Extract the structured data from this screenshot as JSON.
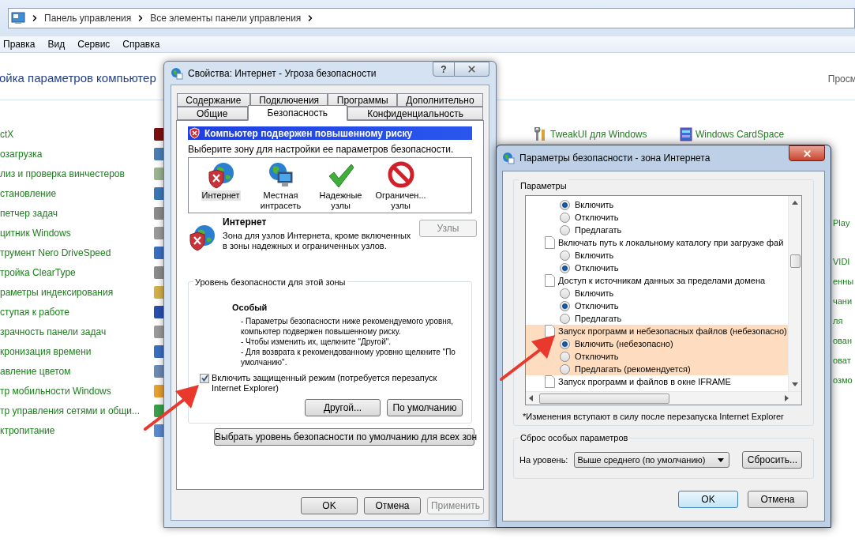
{
  "explorer": {
    "breadcrumb": [
      "Панель управления",
      "Все элементы панели управления"
    ],
    "menu": [
      "Правка",
      "Вид",
      "Сервис",
      "Справка"
    ],
    "heading": "ойка параметров компьютер",
    "view_link": "Просм",
    "items_left": [
      "ctX",
      "озагрузка",
      "лиз и проверка винчестеров",
      "становление",
      "петчер задач",
      "цитник Windows",
      "трумент Nero DriveSpeed",
      "тройка ClearType",
      "раметры индексирования",
      "ступая к работе",
      "зрачность панели задач",
      "кронизация времени",
      "авление цветом",
      "тр мобильности Windows",
      "тр управления сетями и общи...",
      "ктропитание"
    ],
    "items_right": [
      "TweakUI для Windows",
      "Windows CardSpace"
    ],
    "fragments_right": [
      "Play",
      "VIDI",
      "енны",
      "чани",
      "ля",
      "ован",
      "оват",
      "озмо"
    ]
  },
  "properties_dialog": {
    "title": "Свойства: Интернет - Угроза безопасности",
    "help": "?",
    "tab_rows": [
      [
        {
          "label": "Содержание",
          "selected": false
        },
        {
          "label": "Подключения",
          "selected": false
        },
        {
          "label": "Программы",
          "selected": false
        },
        {
          "label": "Дополнительно",
          "selected": false
        }
      ],
      [
        {
          "label": "Общие",
          "selected": false
        },
        {
          "label": "Безопасность",
          "selected": true
        },
        {
          "label": "Конфиденциальность",
          "selected": false
        }
      ]
    ],
    "warning": "Компьютер подвержен повышенному риску",
    "zone_prompt": "Выберите зону для настройки ее параметров безопасности.",
    "zones": [
      {
        "kind": "internet",
        "label": "Интернет",
        "selected": true
      },
      {
        "kind": "intranet",
        "label": "Местная\nинтрасеть",
        "selected": false
      },
      {
        "kind": "trusted",
        "label": "Надежные\nузлы",
        "selected": false
      },
      {
        "kind": "restricted",
        "label": "Ограничен...\nузлы",
        "selected": false
      }
    ],
    "zone_info": {
      "title": "Интернет",
      "description": "Зона для узлов Интернета, кроме включенных в зоны надежных и ограниченных узлов.",
      "sites_button": {
        "label": "Узлы",
        "disabled": true
      }
    },
    "level_group": {
      "legend": "Уровень безопасности для этой зоны",
      "level_name": "Особый",
      "lines": [
        "- Параметры безопасности ниже рекомендуемого уровня, компьютер подвержен повышенному риску.",
        "- Чтобы изменить их, щелкните \"Другой\".",
        "- Для возврата к рекомендованному уровню щелкните \"По умолчанию\"."
      ],
      "protected_mode": {
        "label": "Включить защищенный режим (потребуется перезапуск Internet Explorer)",
        "checked": true
      },
      "buttons": [
        "Другой...",
        "По умолчанию"
      ]
    },
    "reset_all_button": "Выбрать уровень безопасности по умолчанию для всех зон",
    "footer_buttons": [
      {
        "label": "OK",
        "disabled": false
      },
      {
        "label": "Отмена",
        "disabled": false
      },
      {
        "label": "Применить",
        "disabled": true
      }
    ]
  },
  "security_dialog": {
    "title": "Параметры безопасности - зона Интернета",
    "settings_legend": "Параметры",
    "settings": [
      {
        "kind": "option",
        "label": "Включить",
        "selected": true,
        "highlighted": false
      },
      {
        "kind": "option",
        "label": "Отключить",
        "selected": false,
        "highlighted": false
      },
      {
        "kind": "option",
        "label": "Предлагать",
        "selected": false,
        "highlighted": false
      },
      {
        "kind": "setting",
        "label": "Включать путь к локальному каталогу при загрузке фай",
        "highlighted": false
      },
      {
        "kind": "option",
        "label": "Включить",
        "selected": false,
        "highlighted": false
      },
      {
        "kind": "option",
        "label": "Отключить",
        "selected": true,
        "highlighted": false
      },
      {
        "kind": "setting",
        "label": "Доступ к источникам данных за пределами домена",
        "highlighted": false
      },
      {
        "kind": "option",
        "label": "Включить",
        "selected": false,
        "highlighted": false
      },
      {
        "kind": "option",
        "label": "Отключить",
        "selected": true,
        "highlighted": false
      },
      {
        "kind": "option",
        "label": "Предлагать",
        "selected": false,
        "highlighted": false
      },
      {
        "kind": "setting",
        "label": "Запуск программ и небезопасных файлов (небезопасно)",
        "highlighted": true
      },
      {
        "kind": "option",
        "label": "Включить (небезопасно)",
        "selected": true,
        "highlighted": true
      },
      {
        "kind": "option",
        "label": "Отключить",
        "selected": false,
        "highlighted": true
      },
      {
        "kind": "option",
        "label": "Предлагать (рекомендуется)",
        "selected": false,
        "highlighted": true
      },
      {
        "kind": "setting",
        "label": "Запуск программ и файлов в окне IFRAME",
        "highlighted": false
      }
    ],
    "note": "*Изменения вступают в силу после перезапуска Internet Explorer",
    "reset_group": {
      "legend": "Сброс особых параметров",
      "level_label": "На уровень:",
      "level_value": "Выше среднего (по умолчанию)",
      "reset_button": "Сбросить..."
    },
    "footer_buttons": [
      {
        "label": "OK",
        "default": true
      },
      {
        "label": "Отмена",
        "default": false
      }
    ]
  }
}
